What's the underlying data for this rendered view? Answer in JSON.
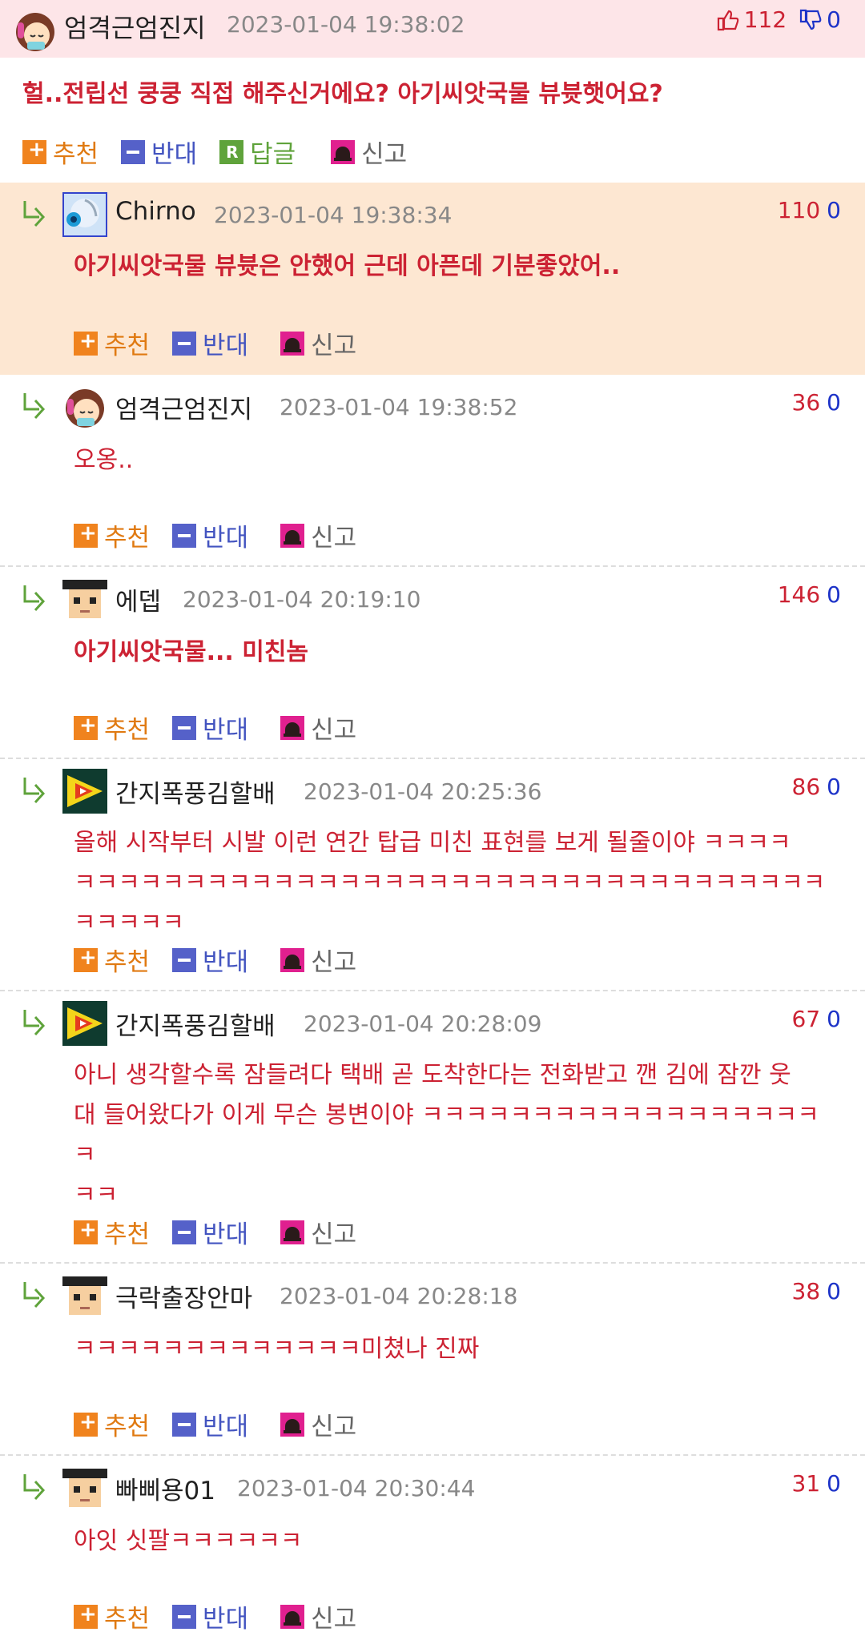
{
  "top": {
    "author": "엄격근엄진지",
    "timestamp": "2023-01-04 19:38:02",
    "up_count": "112",
    "down_count": "0",
    "text": "헐..전립선 쿵쿵 직접 해주신거에요? 아기씨앗국물 뷰븃햇어요?",
    "actions": {
      "recommend": "추천",
      "oppose": "반대",
      "reply": "답글",
      "report": "신고"
    }
  },
  "replies": [
    {
      "author": "Chirno",
      "timestamp": "2023-01-04 19:38:34",
      "up": "110",
      "down": "0",
      "lines": [
        "아기씨앗국물 뷰븃은 안했어 근데 아픈데 기분좋았어.."
      ]
    },
    {
      "author": "엄격근엄진지",
      "timestamp": "2023-01-04 19:38:52",
      "up": "36",
      "down": "0",
      "lines": [
        "오옹.."
      ]
    },
    {
      "author": "에뎁",
      "timestamp": "2023-01-04 20:19:10",
      "up": "146",
      "down": "0",
      "lines": [
        "아기씨앗국물... 미친놈"
      ]
    },
    {
      "author": "간지폭풍김할배",
      "timestamp": "2023-01-04 20:25:36",
      "up": "86",
      "down": "0",
      "lines": [
        "올해 시작부터 시발 이런 연간 탑급 미친 표현를 보게 될줄이야 ㅋㅋㅋㅋ",
        "ㅋㅋㅋㅋㅋㅋㅋㅋㅋㅋㅋㅋㅋㅋㅋㅋㅋㅋㅋㅋㅋㅋㅋㅋㅋㅋㅋㅋㅋㅋㅋㅋㅋㅋㅋㅋㅋㅋㅋ"
      ]
    },
    {
      "author": "간지폭풍김할배",
      "timestamp": "2023-01-04 20:28:09",
      "up": "67",
      "down": "0",
      "lines": [
        "아니 생각할수록 잠들려다 택배 곧 도착한다는 전화받고 깬 김에 잠깐 웃",
        "대 들어왔다가 이게 무슨 봉변이야 ㅋㅋㅋㅋㅋㅋㅋㅋㅋㅋㅋㅋㅋㅋㅋㅋㅋㅋㅋ",
        "ㅋㅋ"
      ]
    },
    {
      "author": "극락출장안마",
      "timestamp": "2023-01-04 20:28:18",
      "up": "38",
      "down": "0",
      "lines": [
        "ㅋㅋㅋㅋㅋㅋㅋㅋㅋㅋㅋㅋㅋ미쳤나 진짜"
      ]
    },
    {
      "author": "빠삐용01",
      "timestamp": "2023-01-04 20:30:44",
      "up": "31",
      "down": "0",
      "lines": [
        "아잇 싯팔ㅋㅋㅋㅋㅋㅋ"
      ]
    }
  ],
  "actions": {
    "recommend": "추천",
    "oppose": "반대",
    "report": "신고"
  },
  "icons": {
    "reply_arrow": "reply-arrow-icon",
    "thumb_up": "thumb-up-icon",
    "thumb_down": "thumb-down-icon"
  },
  "colors": {
    "text_red": "#cc2233",
    "blue": "#1d33c8",
    "highlight_bg": "#fde7d2",
    "top_bg": "#fde5e8"
  }
}
